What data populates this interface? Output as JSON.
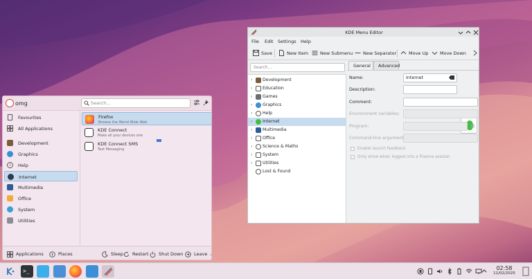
{
  "launcher": {
    "user_name": "omg",
    "search_placeholder": "Search...",
    "categories": [
      {
        "label": "Favourites",
        "icon": "star-icon"
      },
      {
        "label": "All Applications",
        "icon": "grid-icon"
      },
      {
        "label": "Development",
        "icon": "development-icon"
      },
      {
        "label": "Graphics",
        "icon": "graphics-icon"
      },
      {
        "label": "Help",
        "icon": "help-icon"
      },
      {
        "label": "Internet",
        "icon": "globe-icon"
      },
      {
        "label": "Multimedia",
        "icon": "multimedia-icon"
      },
      {
        "label": "Office",
        "icon": "office-icon"
      },
      {
        "label": "System",
        "icon": "system-icon"
      },
      {
        "label": "Utilities",
        "icon": "utilities-icon"
      }
    ],
    "selected_category": "Internet",
    "apps": [
      {
        "name": "Firefox",
        "desc": "Browse the World Wide Web",
        "icon": "firefox-icon"
      },
      {
        "name": "KDE Connect",
        "desc": "Make all your devices one",
        "icon": "kdeconnect-icon"
      },
      {
        "name": "KDE Connect SMS",
        "desc": "Text Messaging",
        "icon": "kdeconnect-sms-icon"
      }
    ],
    "footer": {
      "applications": "Applications",
      "places": "Places",
      "sleep": "Sleep",
      "restart": "Restart",
      "shutdown": "Shut Down",
      "leave": "Leave"
    }
  },
  "editor": {
    "title": "KDE Menu Editor",
    "menu": [
      "File",
      "Edit",
      "Settings",
      "Help"
    ],
    "toolbar": {
      "save": "Save",
      "new_item": "New Item",
      "new_submenu": "New Submenu",
      "new_separator": "New Separator",
      "move_up": "Move Up",
      "move_down": "Move Down"
    },
    "tree_search_placeholder": "Search...",
    "tree": [
      {
        "label": "Development",
        "expander": true
      },
      {
        "label": "Education",
        "expander": true
      },
      {
        "label": "Games",
        "expander": true
      },
      {
        "label": "Graphics",
        "expander": true
      },
      {
        "label": "Help",
        "expander": true
      },
      {
        "label": "Internet",
        "expander": true
      },
      {
        "label": "Multimedia",
        "expander": true
      },
      {
        "label": "Office",
        "expander": true
      },
      {
        "label": "Science & Maths",
        "expander": true
      },
      {
        "label": "System",
        "expander": true
      },
      {
        "label": "Utilities",
        "expander": true
      },
      {
        "label": "Lost & Found",
        "expander": false
      }
    ],
    "selected_tree_item": "Internet",
    "tabs": [
      "General",
      "Advanced"
    ],
    "active_tab": "General",
    "form": {
      "name_label": "Name:",
      "name_value": "Internet",
      "description_label": "Description:",
      "comment_label": "Comment:",
      "env_label": "Environment variables:",
      "program_label": "Program:",
      "args_label": "Command-line arguments:",
      "enable_feedback": "Enable launch feedback",
      "plasma_only": "Only show when logged into a Plasma session"
    }
  },
  "taskbar": {
    "time": "02:58",
    "date": "11/02/2025"
  },
  "colors": {
    "accent": "#3daee9",
    "selection": "#c7dbef"
  }
}
